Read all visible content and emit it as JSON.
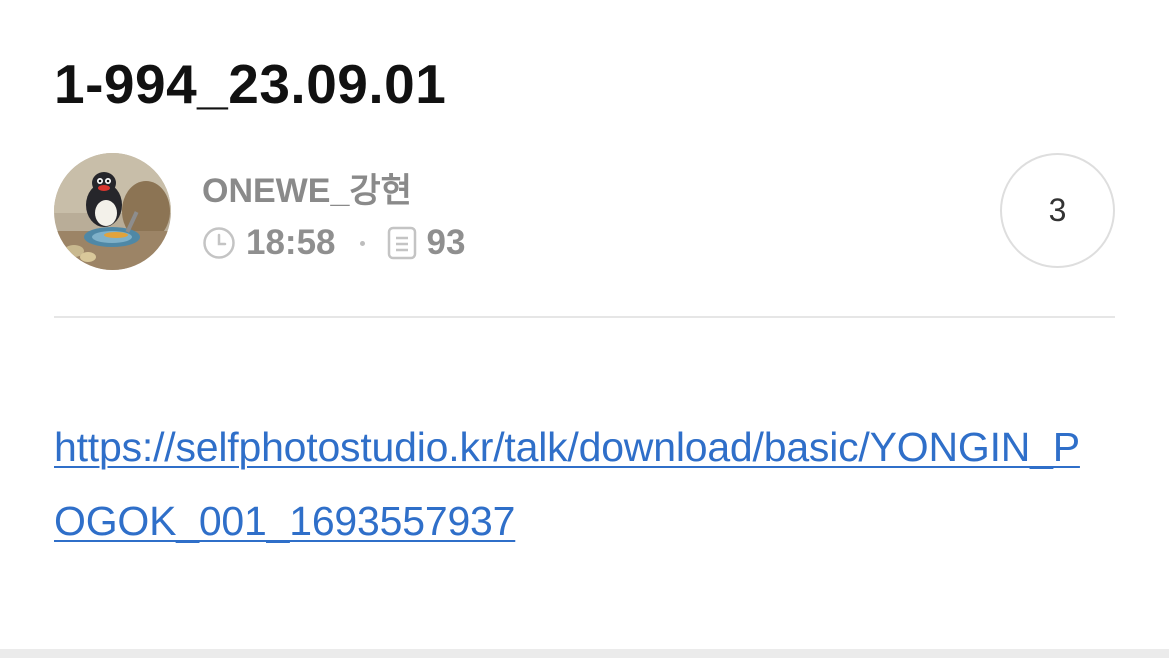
{
  "post": {
    "title": "1-994_23.09.01",
    "author": {
      "name": "ONEWE_강현",
      "avatar_icon": "penguin-avatar-icon"
    },
    "meta": {
      "time": "18:58",
      "views": "93",
      "time_icon": "clock-icon",
      "views_icon": "document-icon"
    },
    "comment_count": "3",
    "link_text": "https://selfphotostudio.kr/talk/download/basic/YONGIN_POGOK_001_1693557937"
  },
  "colors": {
    "title": "#111111",
    "meta_gray": "#8f8f8f",
    "link": "#2f6fc9",
    "divider": "#e6e6e6",
    "circle_border": "#dedede"
  }
}
